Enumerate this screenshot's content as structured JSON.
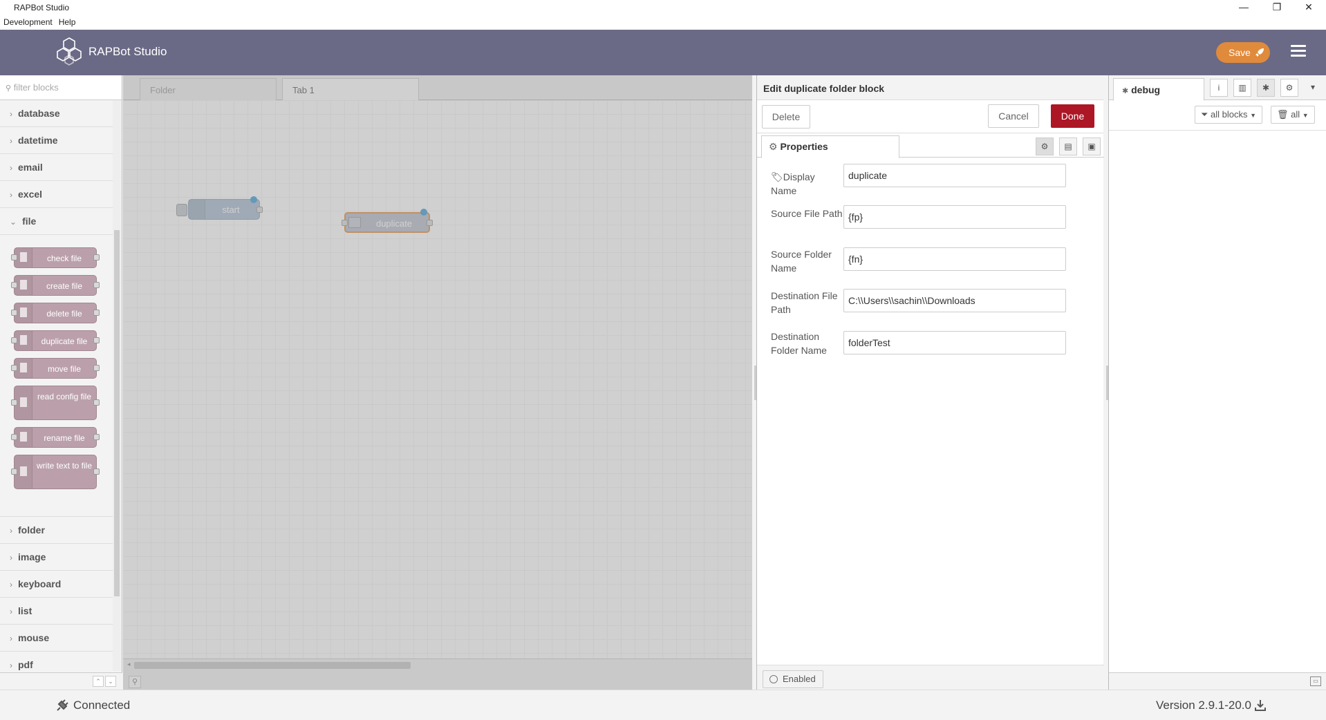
{
  "window": {
    "title": "RAPBot Studio",
    "minimize": "—",
    "restore": "❐",
    "close": "✕"
  },
  "menu": [
    "Development",
    "Help"
  ],
  "header": {
    "brand": "RAPBot Studio",
    "save_label": "Save",
    "save_icon": "rocket-icon",
    "menu_icon": "hamburger-icon",
    "bg_color": "#6a6a86",
    "save_color": "#e08a3c"
  },
  "palette": {
    "search_placeholder": "filter blocks",
    "categories_top": [
      "database",
      "datetime",
      "email",
      "excel",
      "file"
    ],
    "file_nodes": [
      "check file",
      "create file",
      "delete file",
      "duplicate file",
      "move file",
      "read config file",
      "rename file",
      "write text to file"
    ],
    "categories_bottom": [
      "folder",
      "image",
      "keyboard",
      "list",
      "mouse",
      "pdf"
    ]
  },
  "workspace": {
    "tabs": [
      "Folder",
      "Tab 1"
    ],
    "active_tab": "Tab 1",
    "nodes": [
      "start",
      "duplicate"
    ]
  },
  "editor": {
    "title": "Edit duplicate folder block",
    "delete_label": "Delete",
    "cancel_label": "Cancel",
    "done_label": "Done",
    "properties_tab": "Properties",
    "fields": [
      {
        "label": "Display Name",
        "value": "duplicate"
      },
      {
        "label": "Source File Path",
        "value": "{fp}"
      },
      {
        "label": "Source Folder Name",
        "value": "{fn}"
      },
      {
        "label": "Destination File Path",
        "value": "C:\\\\Users\\\\sachin\\\\Downloads"
      },
      {
        "label": "Destination Folder Name",
        "value": "folderTest"
      }
    ],
    "enabled_label": "Enabled",
    "done_color": "#ad1625"
  },
  "sidebar": {
    "tab_label": "debug",
    "filter_label": "all blocks",
    "clear_label": "all"
  },
  "status": {
    "connection": "Connected",
    "version": "Version 2.9.1-20.0"
  }
}
